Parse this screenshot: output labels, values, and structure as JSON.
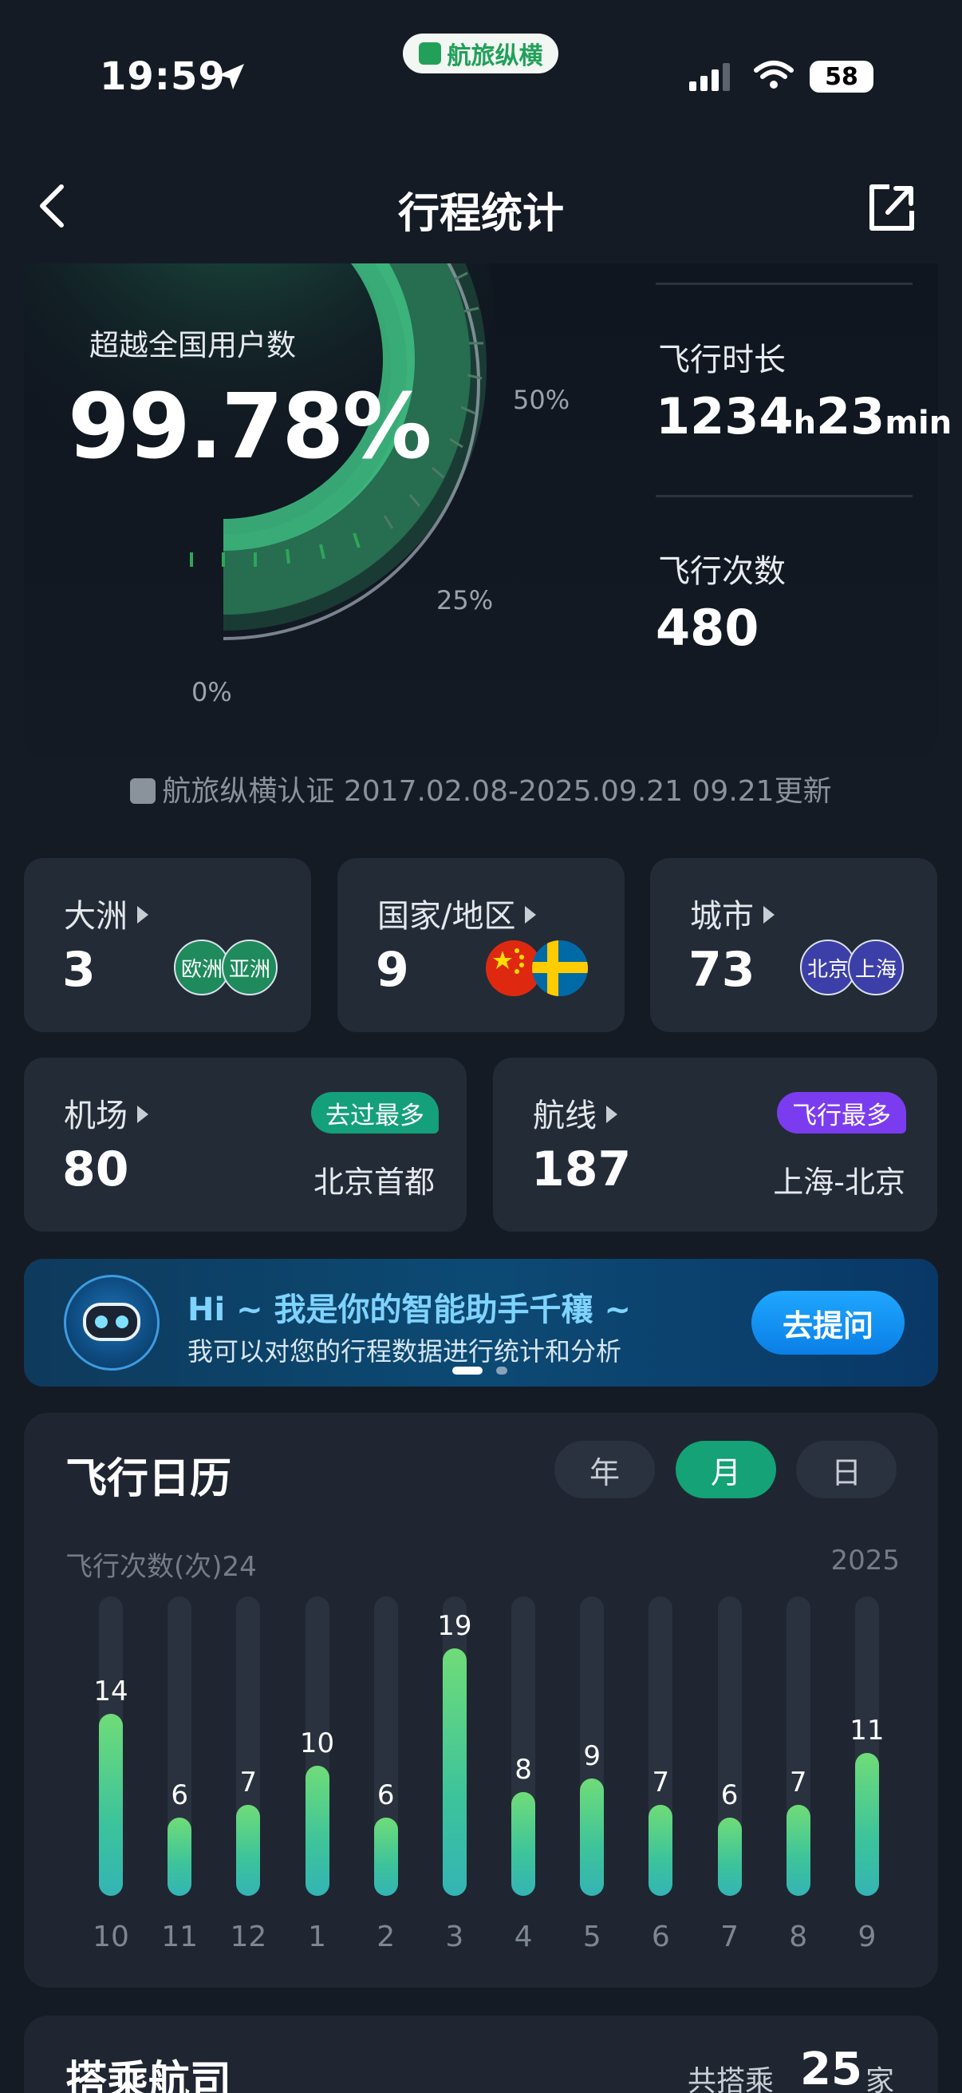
{
  "status_bar": {
    "time": "19:59",
    "app_badge": "航旅纵横",
    "battery": "58"
  },
  "nav": {
    "title": "行程统计"
  },
  "hero": {
    "surpass_label": "超越全国用户数",
    "surpass_value": "99.78%",
    "gauge_percent": 99.78,
    "gauge_ticks": [
      "0%",
      "25%",
      "50%"
    ],
    "flight_duration_label": "飞行时长",
    "flight_hours": "1234",
    "hours_unit": "h",
    "flight_minutes": "23",
    "minutes_unit": "min",
    "flight_count_label": "飞行次数",
    "flight_count": "480",
    "certification": "航旅纵横认证 2017.02.08-2025.09.21 09.21更新"
  },
  "cards": {
    "continents": {
      "label": "大洲",
      "value": "3",
      "dots": [
        "欧洲",
        "亚洲"
      ]
    },
    "countries": {
      "label": "国家/地区",
      "value": "9",
      "flags": [
        "china-flag",
        "sweden-flag"
      ]
    },
    "cities": {
      "label": "城市",
      "value": "73",
      "dots": [
        "北京",
        "上海"
      ]
    },
    "airports": {
      "label": "机场",
      "value": "80",
      "tag": "去过最多",
      "top": "北京首都"
    },
    "routes": {
      "label": "航线",
      "value": "187",
      "tag": "飞行最多",
      "top": "上海-北京"
    }
  },
  "assistant": {
    "title": "Hi ~ 我是你的智能助手千穰 ~",
    "subtitle": "我可以对您的行程数据进行统计和分析",
    "button": "去提问"
  },
  "calendar": {
    "title": "飞行日历",
    "tabs": [
      "年",
      "月",
      "日"
    ],
    "active_tab": "月",
    "y_note": "飞行次数(次)24",
    "year_note": "2025"
  },
  "chart_data": {
    "type": "bar",
    "categories": [
      "10",
      "11",
      "12",
      "1",
      "2",
      "3",
      "4",
      "5",
      "6",
      "7",
      "8",
      "9"
    ],
    "values": [
      14,
      6,
      7,
      10,
      6,
      19,
      8,
      9,
      7,
      6,
      7,
      11
    ],
    "ylim": [
      0,
      23
    ]
  },
  "carrier": {
    "title": "搭乘航司",
    "prefix": "共搭乘",
    "count": "25",
    "suffix": "家"
  },
  "colors": {
    "accent_green": "#14a276",
    "bar_top": "#6fdc78",
    "bar_bottom": "#34b4b4",
    "tag_airport": "#14a07a",
    "tag_route": "#7b3cf0"
  }
}
